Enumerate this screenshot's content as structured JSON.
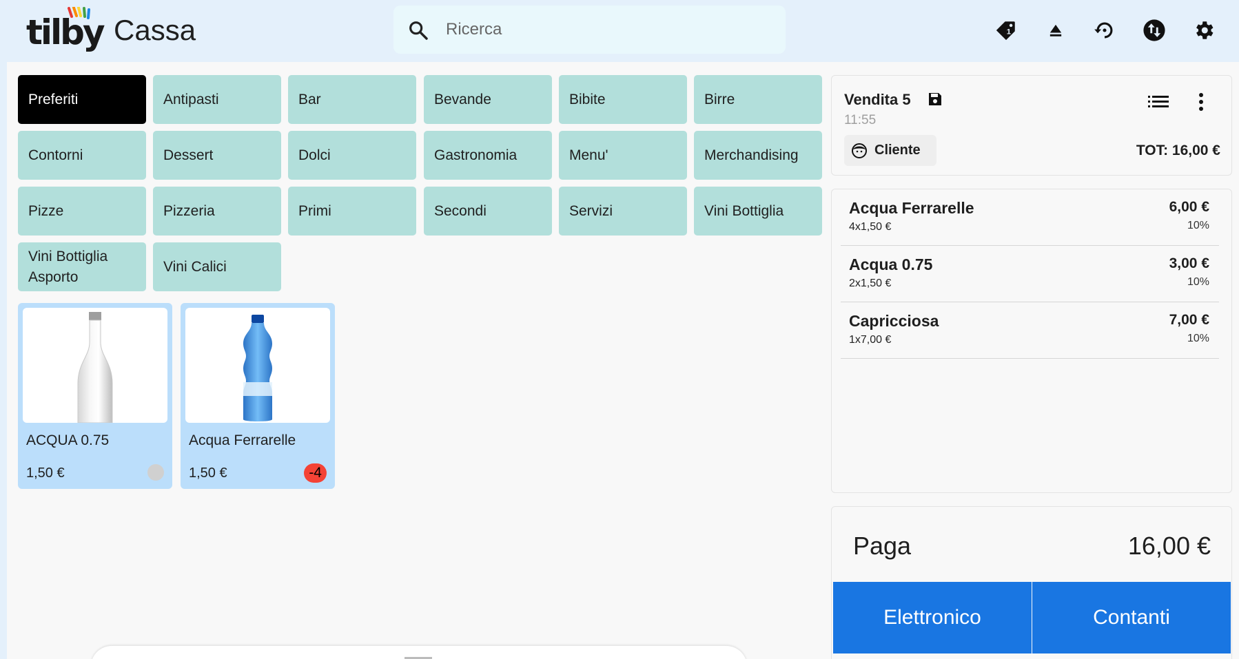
{
  "header": {
    "logo_text": "tilby",
    "app_title": "Cassa",
    "search_placeholder": "Ricerca",
    "icons": [
      "price-tag-icon",
      "eject-icon",
      "history-icon",
      "sync-icon",
      "settings-gear-icon"
    ],
    "price_tag_count": "1"
  },
  "categories": [
    "Preferiti",
    "Antipasti",
    "Bar",
    "Bevande",
    "Bibite",
    "Birre",
    "Contorni",
    "Dessert",
    "Dolci",
    "Gastronomia",
    "Menu'",
    "Merchandising",
    "Pizze",
    "Pizzeria",
    "Primi",
    "Secondi",
    "Servizi",
    "Vini Bottiglia",
    "Vini Bottiglia Asporto",
    "Vini Calici"
  ],
  "active_category": "Preferiti",
  "products": [
    {
      "name": "ACQUA 0.75",
      "price": "1,50 €",
      "stock": ""
    },
    {
      "name": "Acqua Ferrarelle",
      "price": "1,50 €",
      "stock": "-4"
    }
  ],
  "sale": {
    "title": "Vendita 5",
    "time": "11:55",
    "customer_label": "Cliente",
    "total": "TOT: 16,00 €"
  },
  "items": [
    {
      "name": "Acqua Ferrarelle",
      "qty": "4x1,50 €",
      "price": "6,00 €",
      "vat": "10%"
    },
    {
      "name": "Acqua 0.75",
      "qty": "2x1,50 €",
      "price": "3,00 €",
      "vat": "10%"
    },
    {
      "name": "Capricciosa",
      "qty": "1x7,00 €",
      "price": "7,00 €",
      "vat": "10%"
    }
  ],
  "payment": {
    "label": "Paga",
    "amount": "16,00 €",
    "electronic_label": "Elettronico",
    "cash_label": "Contanti"
  },
  "colors": {
    "header_bg": "#e4f0fb",
    "category_bg": "#b2dfdb",
    "category_active_bg": "#000000",
    "product_bg": "#bbdefb",
    "pay_button": "#1976e2",
    "stock_badge": "#f44336"
  }
}
